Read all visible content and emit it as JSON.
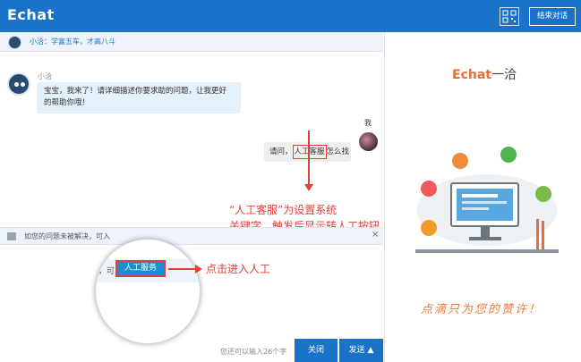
{
  "header": {
    "logo": "Echat",
    "end_chat_label": "结束对话"
  },
  "agent_bar": {
    "name": "小洽",
    "motto": "学富五车，才高八斗"
  },
  "messages": [
    {
      "sender": "小洽",
      "text_line1": "宝宝，我来了！请详细描述你要求助的问题，让我更好",
      "text_line2": "的帮助你哦！"
    },
    {
      "sender": "我",
      "text_before": "请问，",
      "text_keyword": "人工客服",
      "text_after": "怎么找"
    }
  ],
  "annotations": {
    "keyword_note_line1": "“人工客服”为设置系统",
    "keyword_note_line2": "关键字，触发后显示转人工按钮",
    "button_note": "点击进入人工"
  },
  "notice": {
    "text": "如您的问题未被解决，可入",
    "close": "×",
    "human_service_label": "人工服务"
  },
  "footer": {
    "char_hint": "您还可以输入26个字",
    "close_label": "关闭",
    "send_label": "发送 ▲"
  },
  "sidebar": {
    "brand": "Echat",
    "brand_suffix": "一洽",
    "slogan": "点滴只为您的赞许！"
  },
  "colors": {
    "primary": "#1a72c9",
    "accent": "#e0403a",
    "brand_orange": "#ee6a3a"
  }
}
